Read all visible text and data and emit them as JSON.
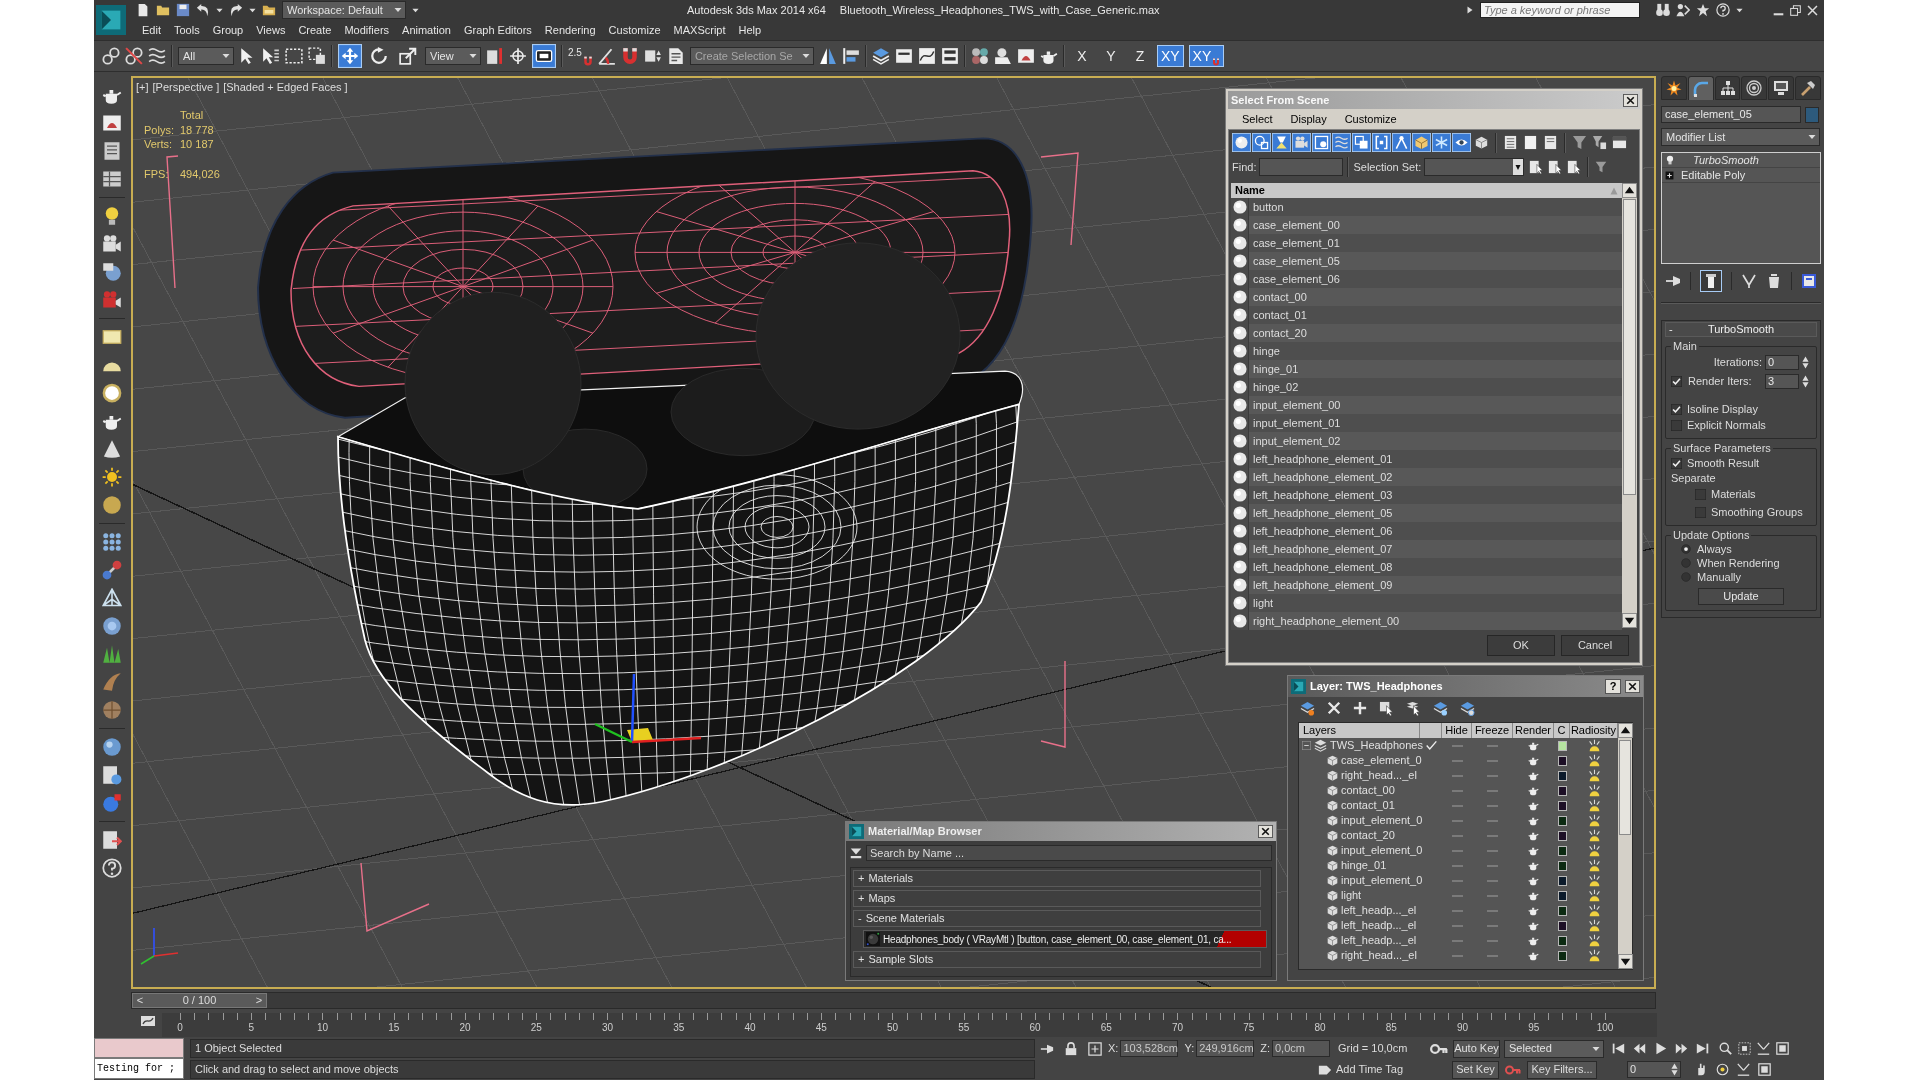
{
  "title_bar": {
    "workspace": "Workspace: Default",
    "app_title": "Autodesk 3ds Max  2014 x64",
    "file_name": "Bluetooth_Wireless_Headphones_TWS_with_Case_Generic.max",
    "search": {
      "placeholder": "Type a keyword or phrase"
    }
  },
  "menu_bar": [
    "Edit",
    "Tools",
    "Group",
    "Views",
    "Create",
    "Modifiers",
    "Animation",
    "Graph Editors",
    "Rendering",
    "Customize",
    "MAXScript",
    "Help"
  ],
  "main_toolbar": {
    "selection_filter": "All",
    "transform_tools": [
      {
        "kind": "move",
        "selected": true
      },
      {
        "kind": "rotate",
        "selected": false
      },
      {
        "kind": "scale",
        "selected": false
      }
    ],
    "reference_coordinate": "View",
    "keyboard_override": {
      "on": true
    },
    "snap_label": "2.5",
    "named_selection": "Create Selection Se",
    "axis_constraints": [
      {
        "kind": "axis",
        "label": "X",
        "selected": false
      },
      {
        "kind": "axis",
        "label": "Y",
        "selected": false
      },
      {
        "kind": "axis",
        "label": "Z",
        "selected": false
      },
      {
        "kind": "axis",
        "label": "XY",
        "selected": true
      },
      {
        "kind": "snap-axis",
        "label": "XY",
        "selected": true
      }
    ]
  },
  "viewport": {
    "active": true,
    "labels": [
      "[+]",
      "[Perspective ]",
      "[Shaded + Edged Faces ]"
    ],
    "stats": {
      "header": "Total",
      "rows": [
        {
          "kind": "count",
          "label": "Polys:",
          "value": "18 778"
        },
        {
          "kind": "count",
          "label": "Verts:",
          "value": "10 187"
        },
        {
          "kind": "fps",
          "label": "FPS:",
          "value": "494,026"
        }
      ]
    }
  },
  "select_from_scene": {
    "title": "Select From Scene",
    "menus": [
      "Select",
      "Display",
      "Customize"
    ],
    "filters": [
      {
        "on": true
      },
      {
        "on": true
      },
      {
        "on": true
      },
      {
        "on": true
      },
      {
        "on": true
      },
      {
        "on": true
      },
      {
        "on": true
      },
      {
        "on": true
      },
      {
        "on": true
      },
      {
        "on": true
      },
      {
        "on": true
      },
      {
        "on": true
      },
      {
        "on": false
      }
    ],
    "find_label": "Find:",
    "selection_set_label": "Selection Set:",
    "column": "Name",
    "rows": [
      {
        "name": "button",
        "selected": false
      },
      {
        "name": "case_element_00",
        "selected": false
      },
      {
        "name": "case_element_01",
        "selected": false
      },
      {
        "name": "case_element_05",
        "selected": false
      },
      {
        "name": "case_element_06",
        "selected": false
      },
      {
        "name": "contact_00",
        "selected": false
      },
      {
        "name": "contact_01",
        "selected": false
      },
      {
        "name": "contact_20",
        "selected": false
      },
      {
        "name": "hinge",
        "selected": false
      },
      {
        "name": "hinge_01",
        "selected": false
      },
      {
        "name": "hinge_02",
        "selected": false
      },
      {
        "name": "input_element_00",
        "selected": false
      },
      {
        "name": "input_element_01",
        "selected": false
      },
      {
        "name": "input_element_02",
        "selected": false
      },
      {
        "name": "left_headphone_element_01",
        "selected": false
      },
      {
        "name": "left_headphone_element_02",
        "selected": false
      },
      {
        "name": "left_headphone_element_03",
        "selected": false
      },
      {
        "name": "left_headphone_element_05",
        "selected": false
      },
      {
        "name": "left_headphone_element_06",
        "selected": false
      },
      {
        "name": "left_headphone_element_07",
        "selected": false
      },
      {
        "name": "left_headphone_element_08",
        "selected": false
      },
      {
        "name": "left_headphone_element_09",
        "selected": false
      },
      {
        "name": "light",
        "selected": false
      },
      {
        "name": "right_headphone_element_00",
        "selected": false
      }
    ],
    "buttons": [
      "OK",
      "Cancel"
    ]
  },
  "layer_manager": {
    "title": "Layer: TWS_Headphones",
    "help": "?",
    "columns": [
      "Layers",
      "Hide",
      "Freeze",
      "Render",
      "C",
      "Radiosity"
    ],
    "layers": [
      {
        "name": "TWS_Headphones",
        "current": true,
        "expanded": true,
        "color": "#b6e4a0",
        "children": [
          {
            "name": "case_element_0",
            "color": "#1d0f26"
          },
          {
            "name": "right_head..._el",
            "color": "#0b1a2b"
          },
          {
            "name": "contact_00",
            "color": "#1d0f26"
          },
          {
            "name": "contact_01",
            "color": "#1d0f26"
          },
          {
            "name": "input_element_0",
            "color": "#0c2a12"
          },
          {
            "name": "contact_20",
            "color": "#1d0f26"
          },
          {
            "name": "input_element_0",
            "color": "#0c2a12"
          },
          {
            "name": "hinge_01",
            "color": "#0c2a12"
          },
          {
            "name": "input_element_0",
            "color": "#0b1a2b"
          },
          {
            "name": "light",
            "color": "#0b1a2b"
          },
          {
            "name": "left_headp..._el",
            "color": "#0c2a12"
          },
          {
            "name": "left_headp..._el",
            "color": "#1d0f26"
          },
          {
            "name": "left_headp..._el",
            "color": "#0c2a12"
          },
          {
            "name": "right_head..._el",
            "color": "#0c2a12"
          }
        ]
      }
    ]
  },
  "material_browser": {
    "title": "Material/Map Browser",
    "search": {
      "placeholder": "Search by Name ..."
    },
    "groups": [
      {
        "toggle": "+",
        "label": "Materials"
      },
      {
        "toggle": "+",
        "label": "Maps"
      },
      {
        "toggle": "-",
        "label": "Scene Materials",
        "materials": [
          {
            "name": "Headphones_body  ( VRayMtl ) [button, case_element_00, case_element_01, ca..."
          }
        ]
      },
      {
        "toggle": "+",
        "label": "Sample Slots"
      }
    ]
  },
  "command_panel": {
    "tabs": [
      {
        "kind": "create",
        "selected": false
      },
      {
        "kind": "modify",
        "selected": true
      },
      {
        "kind": "hierarchy",
        "selected": false
      },
      {
        "kind": "motion",
        "selected": false
      },
      {
        "kind": "display",
        "selected": false
      },
      {
        "kind": "utilities",
        "selected": false
      }
    ],
    "object_name": "case_element_05",
    "modifier_list": "Modifier List",
    "stack": [
      {
        "kind": "modifier",
        "label": "TurboSmooth",
        "off_in_viewport": true,
        "selected": false
      },
      {
        "kind": "base",
        "label": "Editable Poly",
        "selected": false
      }
    ],
    "show_end_result": {
      "on": true
    },
    "rollout": {
      "toggle": "-",
      "title": "TurboSmooth",
      "groups": [
        {
          "title": "Main",
          "controls": [
            {
              "kind": "spinner",
              "label": "Iterations:",
              "value": "0"
            },
            {
              "kind": "check-spinner",
              "label": "Render Iters:",
              "checked": true,
              "value": "3"
            },
            {
              "kind": "checkbox",
              "label": "Isoline Display",
              "checked": true
            },
            {
              "kind": "checkbox",
              "label": "Explicit Normals",
              "checked": false
            }
          ]
        },
        {
          "title": "Surface Parameters",
          "controls": [
            {
              "kind": "checkbox",
              "label": "Smooth Result",
              "checked": true
            },
            {
              "kind": "label",
              "label": "Separate",
              "children": [
                {
                  "kind": "checkbox",
                  "label": "Materials",
                  "checked": false
                },
                {
                  "kind": "checkbox",
                  "label": "Smoothing Groups",
                  "checked": false
                }
              ]
            }
          ]
        },
        {
          "title": "Update Options",
          "controls": [
            {
              "kind": "radio",
              "label": "Always",
              "selected": true
            },
            {
              "kind": "radio",
              "label": "When Rendering",
              "selected": false
            },
            {
              "kind": "radio",
              "label": "Manually",
              "selected": false
            },
            {
              "kind": "button",
              "label": "Update"
            }
          ]
        }
      ]
    }
  },
  "time_slider": {
    "prev": "<",
    "position": "0 / 100",
    "next": ">",
    "level": 0
  },
  "track_bar": {
    "ticks": [
      "0",
      "5",
      "10",
      "15",
      "20",
      "25",
      "30",
      "35",
      "40",
      "45",
      "50",
      "55",
      "60",
      "65",
      "70",
      "75",
      "80",
      "85",
      "90",
      "95",
      "100"
    ]
  },
  "status_bar": {
    "listener": "Testing for ;",
    "selection_info": "1 Object Selected",
    "prompt": "Click and drag to select and move objects",
    "coords": [
      {
        "label": "X:",
        "value": "103,528cm"
      },
      {
        "label": "Y:",
        "value": "249,916cm"
      },
      {
        "label": "Z:",
        "value": "0,0cm"
      }
    ],
    "grid": "Grid = 10,0cm",
    "auto_key": {
      "label": "Auto Key",
      "on": false
    },
    "key_mode": "Selected",
    "add_time_tag": "Add Time Tag",
    "set_key": "Set Key",
    "key_filters": "Key Filters...",
    "current_frame": "0"
  }
}
